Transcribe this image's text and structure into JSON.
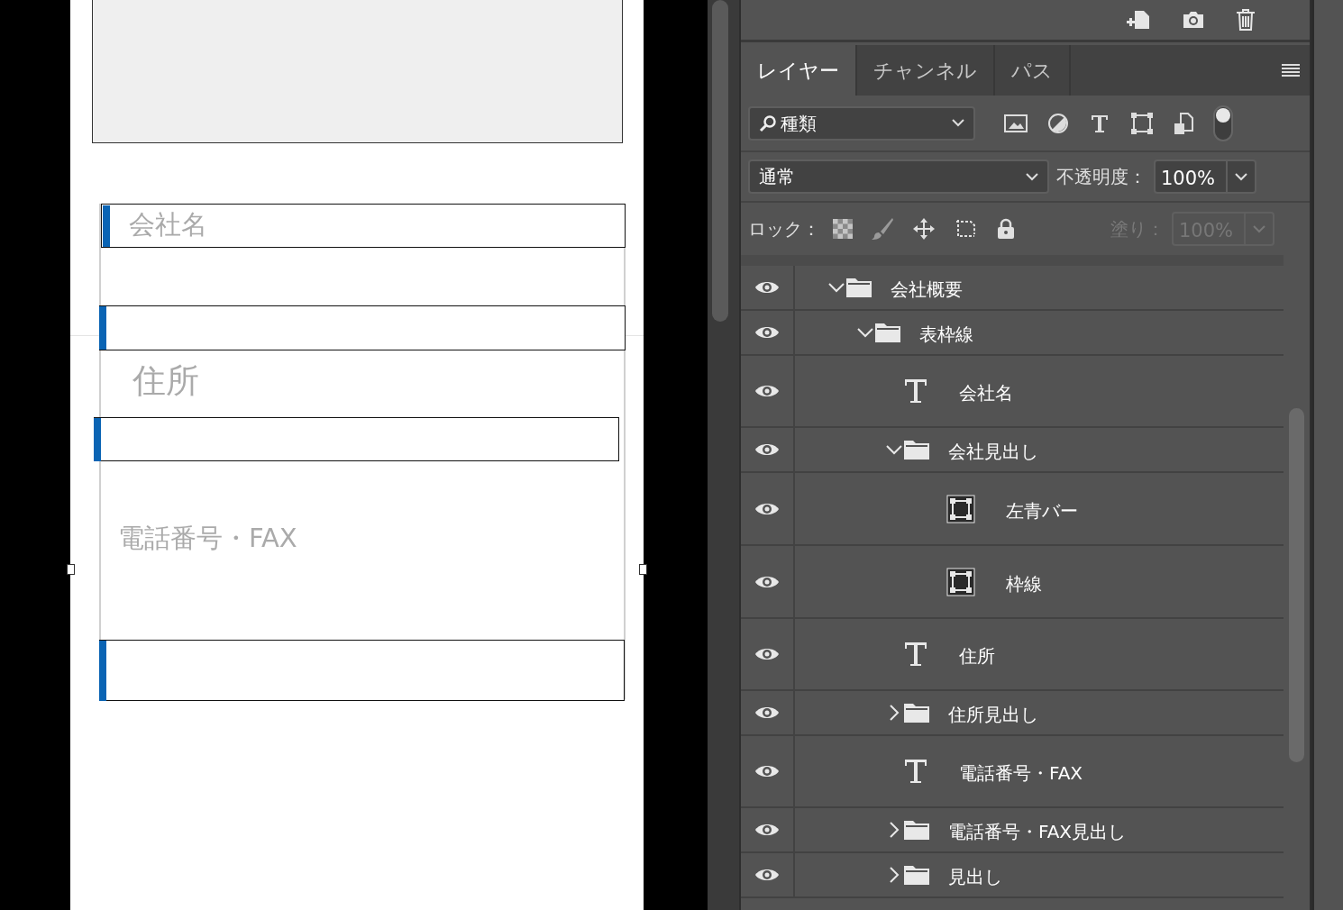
{
  "canvas": {
    "labels": [
      {
        "kind": "small",
        "text": "会社名"
      },
      {
        "kind": "large",
        "text": "住所"
      },
      {
        "kind": "small",
        "text": "電話番号・FAX"
      }
    ]
  },
  "tabs": [
    {
      "label": "レイヤー",
      "selected": true
    },
    {
      "label": "チャンネル",
      "selected": false
    },
    {
      "label": "パス",
      "selected": false
    }
  ],
  "filter": {
    "value": "種類",
    "on": true
  },
  "blend_mode": {
    "value": "通常"
  },
  "opacity": {
    "label": "不透明度：",
    "value": "100%"
  },
  "lock": {
    "label": "ロック："
  },
  "fill": {
    "label": "塗り：",
    "value": "100%",
    "disabled": true
  },
  "layers": [
    {
      "name": "会社概要",
      "kind": "folder",
      "visible": true,
      "expanded": true,
      "children": [
        {
          "name": "表枠線",
          "kind": "folder",
          "visible": true,
          "expanded": true,
          "children": [
            {
              "name": "会社名",
              "kind": "text",
              "visible": true
            },
            {
              "name": "会社見出し",
              "kind": "folder",
              "visible": true,
              "expanded": true,
              "children": [
                {
                  "name": "左青バー",
                  "kind": "shape",
                  "visible": true
                },
                {
                  "name": "枠線",
                  "kind": "shape",
                  "visible": true
                }
              ]
            },
            {
              "name": "住所",
              "kind": "text",
              "visible": true
            },
            {
              "name": "住所見出し",
              "kind": "folder",
              "visible": true,
              "expanded": false
            },
            {
              "name": "電話番号・FAX",
              "kind": "text",
              "visible": true
            },
            {
              "name": "電話番号・FAX見出し",
              "kind": "folder",
              "visible": true,
              "expanded": false
            },
            {
              "name": "見出し",
              "kind": "folder",
              "visible": true,
              "expanded": false
            }
          ]
        }
      ]
    }
  ]
}
